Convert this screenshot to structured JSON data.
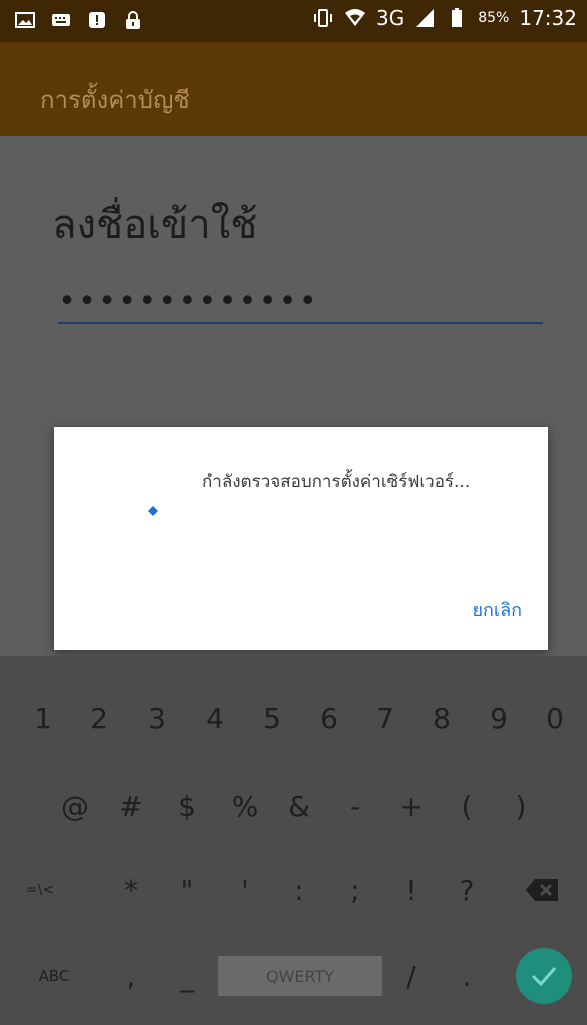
{
  "status_bar": {
    "network": "3G",
    "battery_percent": "85%",
    "time": "17:32"
  },
  "app_bar": {
    "title": "การตั้งค่าบัญชี"
  },
  "main": {
    "heading": "ลงชื่อเข้าใช้",
    "password_value": "•••••••••••••"
  },
  "dialog": {
    "message": "กำลังตรวจสอบการตั้งค่าเซิร์ฟเวอร์...",
    "cancel_label": "ยกเลิก"
  },
  "keyboard": {
    "row1": [
      "1",
      "2",
      "3",
      "4",
      "5",
      "6",
      "7",
      "8",
      "9",
      "0"
    ],
    "row2": [
      "@",
      "#",
      "$",
      "%",
      "&",
      "-",
      "+",
      "(",
      ")"
    ],
    "row3": [
      "=\\<",
      "*",
      "\"",
      "'",
      ":",
      ";",
      "!",
      "?"
    ],
    "row4": [
      "ABC",
      ",",
      "_",
      "QWERTY",
      "/",
      "."
    ]
  }
}
